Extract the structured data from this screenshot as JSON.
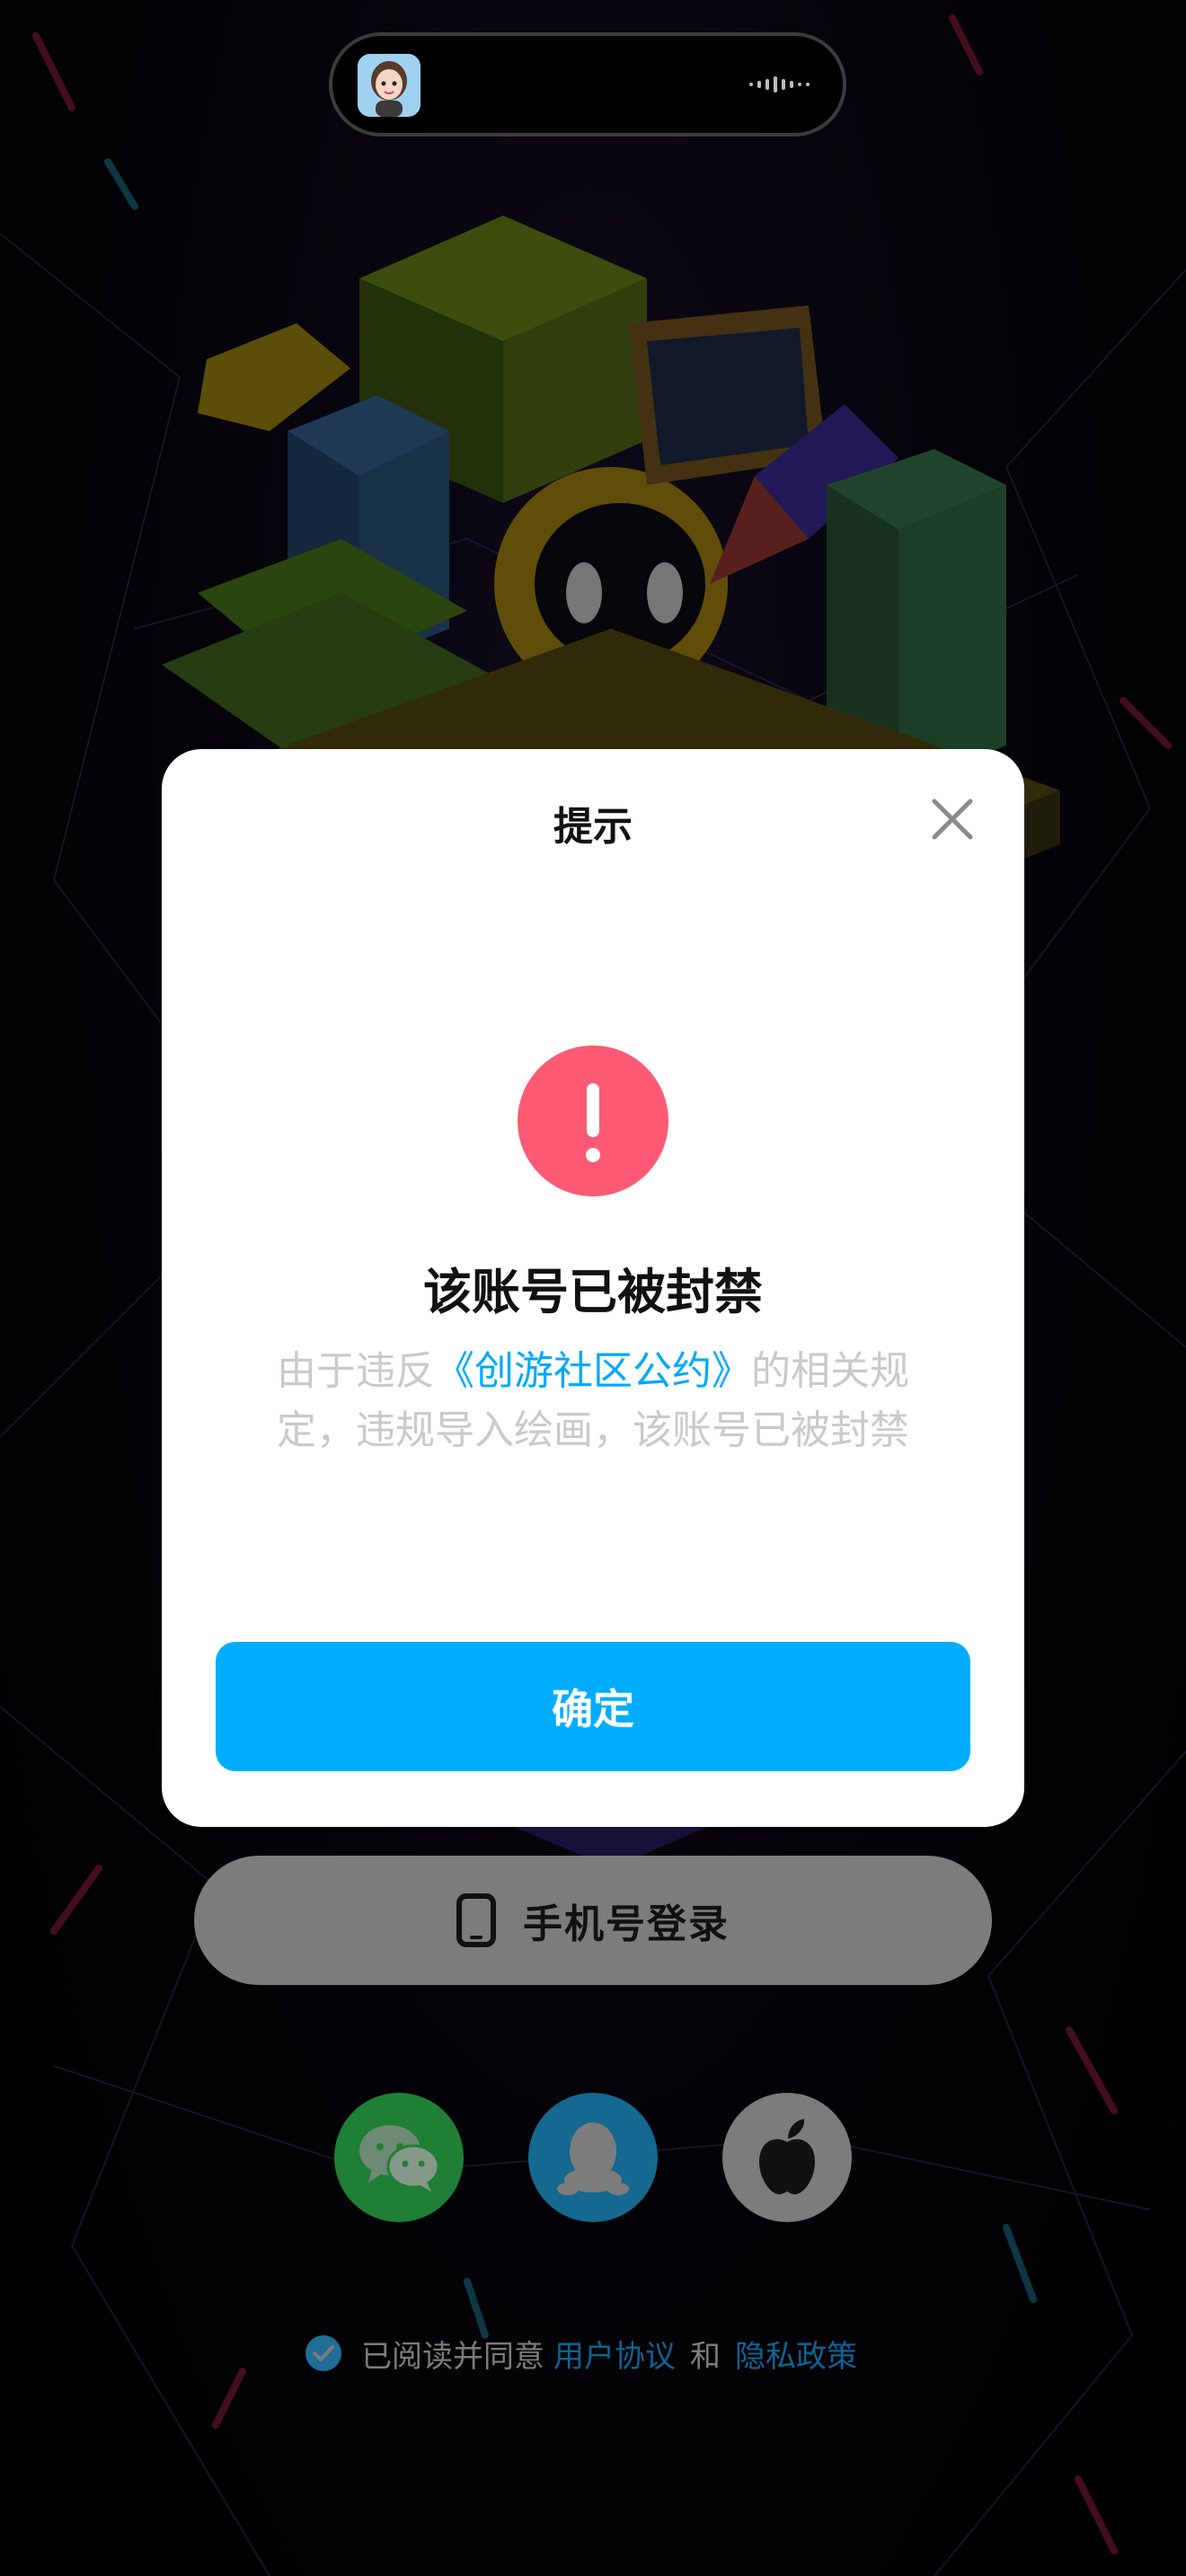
{
  "modal": {
    "title": "提示",
    "heading": "该账号已被封禁",
    "message_before": "由于违反",
    "message_link": "《创游社区公约》",
    "message_after": "的相关规定，违规导入绘画，该账号已被封禁",
    "confirm_label": "确定"
  },
  "login": {
    "phone_label": "手机号登录",
    "social": [
      {
        "name": "wechat",
        "icon": "wechat-icon"
      },
      {
        "name": "qq",
        "icon": "qq-icon"
      },
      {
        "name": "apple",
        "icon": "apple-icon"
      }
    ],
    "agreement": {
      "prefix": "已阅读并同意",
      "user_agreement": "用户协议",
      "and": "和",
      "privacy_policy": "隐私政策"
    }
  },
  "colors": {
    "accent": "#00adff",
    "alert": "#fc5a74",
    "link": "#00a9fb"
  }
}
